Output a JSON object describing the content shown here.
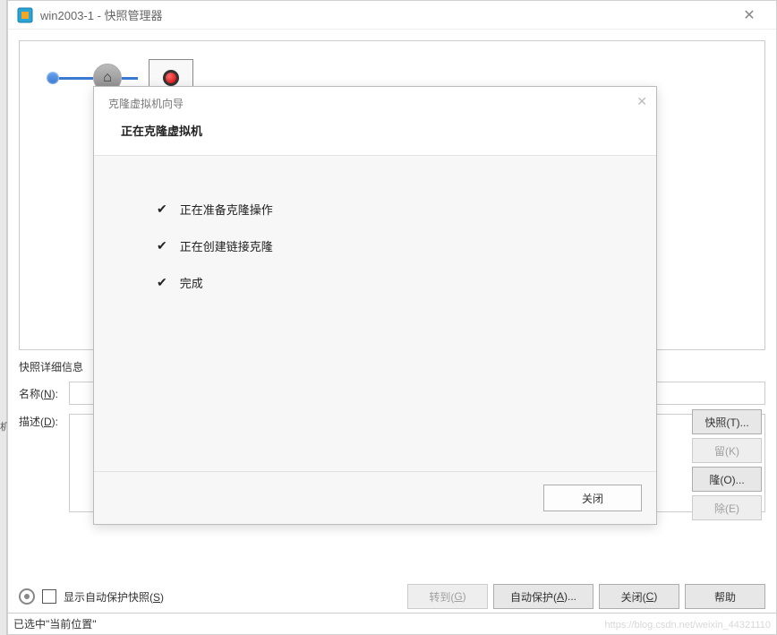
{
  "window": {
    "title": "win2003-1 - 快照管理器"
  },
  "snapshot_details": {
    "section_title": "快照详细信息",
    "name_label": "名称(N):",
    "name_label_char": "N",
    "desc_label": "描述(D):",
    "desc_label_char": "D",
    "name_value": "",
    "desc_value": ""
  },
  "right_buttons": {
    "snapshot": "快照(T)...",
    "keep": "留(K)",
    "clone": "隆(O)...",
    "delete": "除(E)"
  },
  "bottom": {
    "checkbox_label": "显示自动保护快照(S)",
    "checkbox_key": "S",
    "goto": "转到(G)",
    "auto_protect": "自动保护(A)...",
    "close": "关闭(C)",
    "help": "帮助"
  },
  "status_bar": "已选中\"当前位置\"",
  "watermark": "https://blog.csdn.net/weixin_44321110",
  "modal": {
    "wizard_title": "克隆虚拟机向导",
    "subtitle": "正在克隆虚拟机",
    "items": [
      "正在准备克隆操作",
      "正在创建链接克隆",
      "完成"
    ],
    "close_button": "关闭"
  },
  "left_edge_char": "机"
}
